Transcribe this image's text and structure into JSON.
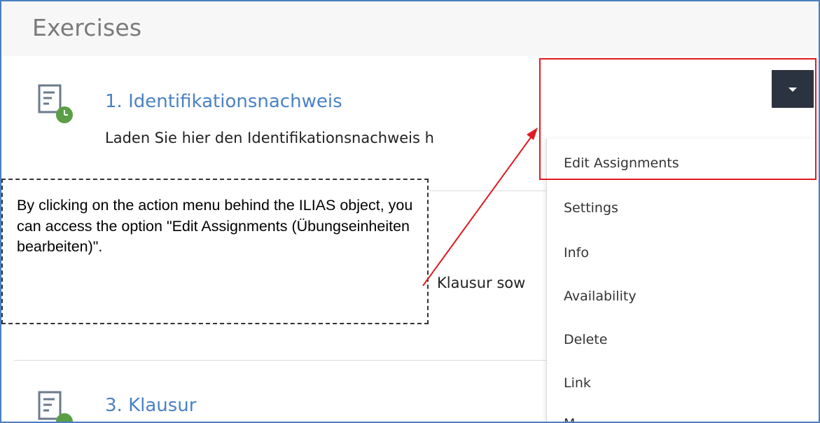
{
  "section": {
    "title": "Exercises"
  },
  "items": [
    {
      "icon": "exercise-icon",
      "title": "1. Identifikationsnachweis",
      "description": "Laden Sie hier den Identifikationsnachweis h"
    },
    {
      "icon": "exercise-icon",
      "title": "",
      "description": "Klausur sow"
    },
    {
      "icon": "exercise-icon",
      "title": "3. Klausur",
      "description": ""
    }
  ],
  "actions_menu": {
    "toggle_icon": "caret-down-icon",
    "items": [
      "Edit Assignments",
      "Settings",
      "Info",
      "Availability",
      "Delete",
      "Link",
      "M"
    ]
  },
  "callout": {
    "text": "By clicking on the action menu behind the ILIAS object, you can access the option \"Edit Assignments (Übungseinheiten bearbeiten)\"."
  },
  "colors": {
    "link": "#4a82c3",
    "highlight": "#e01b24",
    "toggle_bg": "#2c3340",
    "icon_green": "#5a9f45",
    "frame_border": "#4a7fc1"
  }
}
